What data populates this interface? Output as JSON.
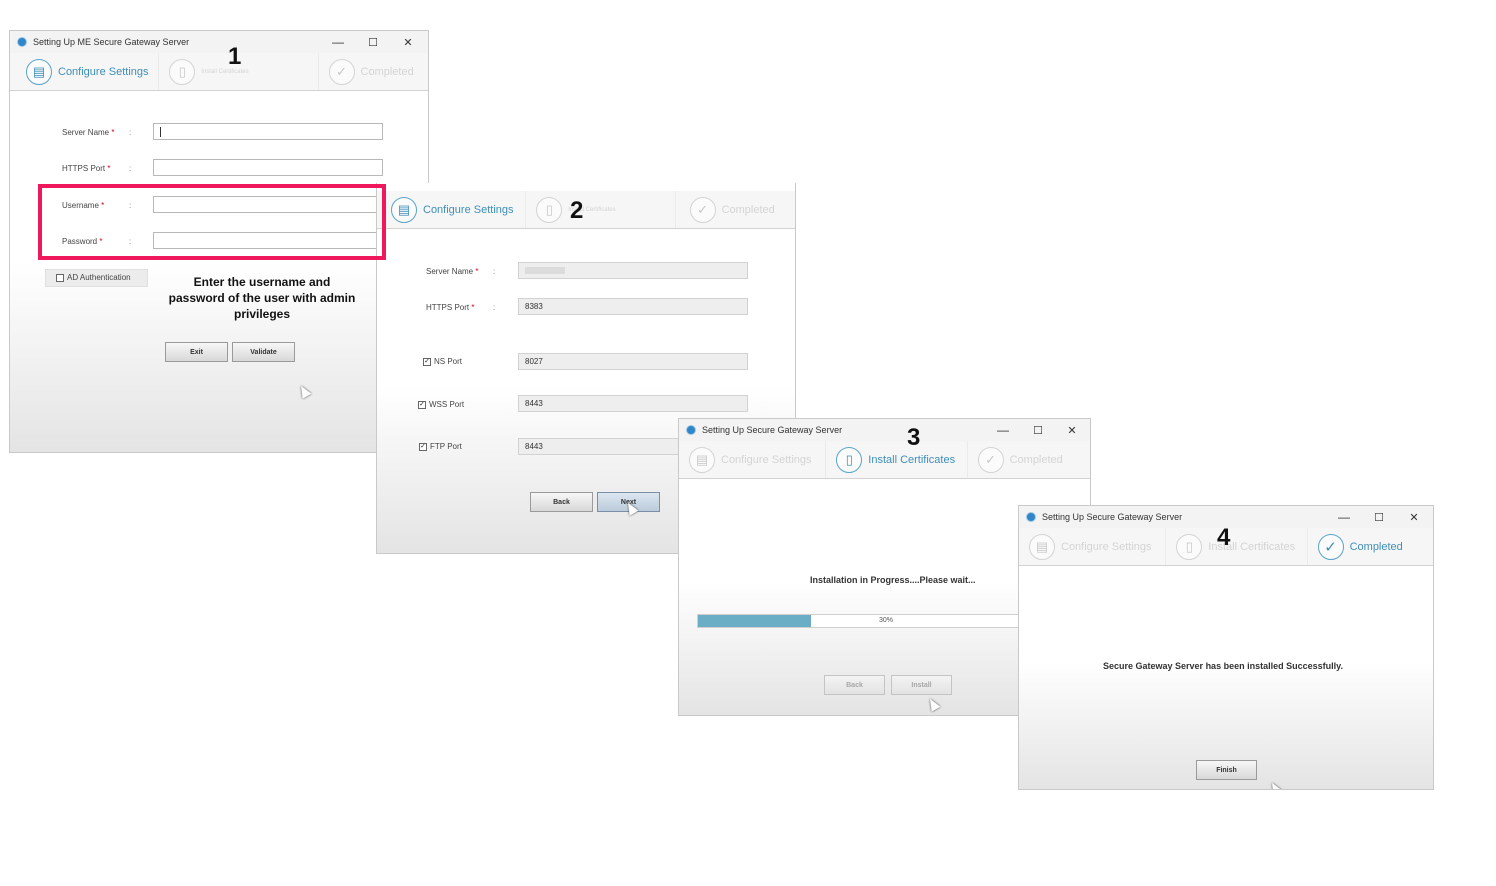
{
  "step_labels": {
    "configure": "Configure Settings",
    "install": "Install Certificates",
    "install_small": "Install Certificates",
    "completed": "Completed"
  },
  "window1": {
    "title": "Setting Up ME Secure Gateway Server",
    "number": "1",
    "fields": {
      "server_name": "Server Name",
      "https_port": "HTTPS Port",
      "username": "Username",
      "password": "Password"
    },
    "required_mark": "*",
    "colon": ":",
    "ad_auth": "AD Authentication",
    "buttons": {
      "exit": "Exit",
      "validate": "Validate"
    }
  },
  "annotation": {
    "line1": "Enter the  username and",
    "line2": "password of the user with admin",
    "line3": "privileges"
  },
  "window2": {
    "number": "2",
    "fields": {
      "server_name": "Server Name",
      "https_port": "HTTPS Port",
      "ns_port": "NS Port",
      "wss_port": "WSS Port",
      "ftp_port": "FTP Port"
    },
    "values": {
      "https_port": "8383",
      "ns_port": "8027",
      "wss_port": "8443",
      "ftp_port": "8443"
    },
    "checkmark": "✓",
    "buttons": {
      "back": "Back",
      "next": "Next"
    }
  },
  "window3": {
    "title": "Setting Up Secure Gateway Server",
    "number": "3",
    "message": "Installation in Progress....Please wait...",
    "progress_percent": 30,
    "progress_label": "30%",
    "buttons": {
      "back": "Back",
      "install": "Install"
    }
  },
  "window4": {
    "title": "Setting Up Secure Gateway Server",
    "number": "4",
    "message": "Secure Gateway Server has been installed Successfully.",
    "buttons": {
      "finish": "Finish"
    }
  },
  "window_controls": {
    "minimize": "—",
    "maximize": "☐",
    "close": "✕"
  },
  "icons": {
    "app": "app-logo-icon",
    "configure": "server-settings-icon",
    "install": "certificate-icon",
    "completed": "checkmark-icon"
  },
  "colors": {
    "accent": "#3e8fb8",
    "highlight": "#f0185d",
    "progress": "#6aaec6"
  }
}
